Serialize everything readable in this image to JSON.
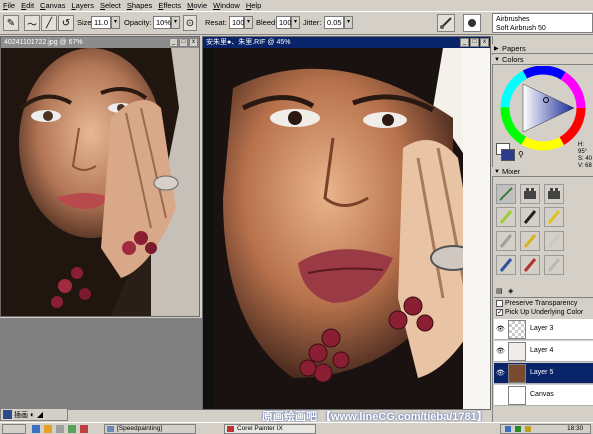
{
  "menu": [
    "File",
    "Edit",
    "Canvas",
    "Layers",
    "Select",
    "Shapes",
    "Effects",
    "Movie",
    "Window",
    "Help"
  ],
  "propbar": {
    "size_label": "Size:",
    "size_value": "11.0",
    "opacity_label": "Opacity:",
    "opacity_value": "10%",
    "resat_label": "Resat:",
    "resat_value": "100",
    "bleed_label": "Bleed:",
    "bleed_value": "100",
    "jitter_label": "Jitter:",
    "jitter_value": "0.05"
  },
  "brush": {
    "category": "Airbrushes",
    "variant": "Soft Airbrush 50"
  },
  "windows": {
    "reference": {
      "title": "40241101722.jpg @ 67%"
    },
    "painting": {
      "title": "安朱里●、朱里.RIF @ 45%"
    }
  },
  "palettes": {
    "papers": "Papers",
    "colors": "Colors",
    "mixer": "Mixer",
    "hsv": {
      "h": "H: 95°",
      "s": "S: 40",
      "v": "V: 68"
    }
  },
  "layers": {
    "preserve_transparency": "Preserve Transparency",
    "pick_up_underlying": "Pick Up Underlying Color",
    "items": [
      {
        "name": "Layer 3"
      },
      {
        "name": "Layer 4"
      },
      {
        "name": "Layer 5"
      },
      {
        "name": "Canvas"
      }
    ]
  },
  "watermark": "原画绘画吧 【www.lineCG.com/tieba/1781】",
  "statusbar": {
    "label": "插画"
  },
  "taskbar": {
    "tasks": [
      "[Speedpainting]",
      "Corel Painter IX"
    ],
    "clock": "18:30"
  },
  "colors": {
    "menu_bg": "#d4d0c8",
    "active_title": "#0a246a",
    "inactive_title": "#8c8c8c",
    "selected_layer": "#0a246a",
    "current_color": "#2c3c8a"
  }
}
